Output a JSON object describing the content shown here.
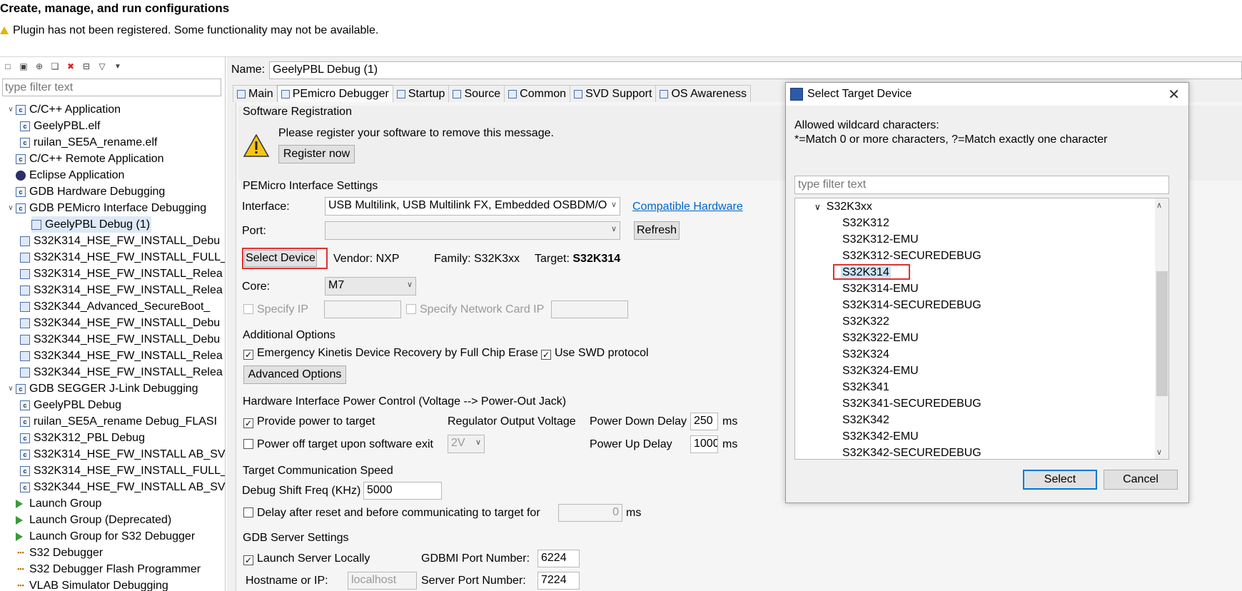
{
  "window_title": "Create, manage, and run configurations",
  "warning": "Plugin has not been registered. Some functionality may not be available.",
  "left": {
    "filter_placeholder": "type filter text",
    "items": [
      {
        "label": "C/C++ Application",
        "expanded": true
      },
      {
        "label": "GeelyPBL.elf"
      },
      {
        "label": "ruilan_SE5A_rename.elf"
      },
      {
        "label": "C/C++ Remote Application"
      },
      {
        "label": "Eclipse Application"
      },
      {
        "label": "GDB Hardware Debugging"
      },
      {
        "label": "GDB PEMicro Interface Debugging",
        "expanded": true
      },
      {
        "label": "GeelyPBL Debug (1)",
        "selected": true
      },
      {
        "label": "S32K314_HSE_FW_INSTALL_Debu"
      },
      {
        "label": "S32K314_HSE_FW_INSTALL_FULL_"
      },
      {
        "label": "S32K314_HSE_FW_INSTALL_Relea"
      },
      {
        "label": "S32K314_HSE_FW_INSTALL_Relea"
      },
      {
        "label": "S32K344_Advanced_SecureBoot_"
      },
      {
        "label": "S32K344_HSE_FW_INSTALL_Debu"
      },
      {
        "label": "S32K344_HSE_FW_INSTALL_Debu"
      },
      {
        "label": "S32K344_HSE_FW_INSTALL_Relea"
      },
      {
        "label": "S32K344_HSE_FW_INSTALL_Relea"
      },
      {
        "label": "GDB SEGGER J-Link Debugging",
        "expanded": true
      },
      {
        "label": "GeelyPBL Debug"
      },
      {
        "label": "ruilan_SE5A_rename Debug_FLASI"
      },
      {
        "label": "S32K312_PBL Debug"
      },
      {
        "label": "S32K314_HSE_FW_INSTALL AB_SV"
      },
      {
        "label": "S32K314_HSE_FW_INSTALL_FULL_"
      },
      {
        "label": "S32K344_HSE_FW_INSTALL AB_SV"
      },
      {
        "label": "Launch Group"
      },
      {
        "label": "Launch Group (Deprecated)"
      },
      {
        "label": "Launch Group for S32 Debugger"
      },
      {
        "label": "S32 Debugger"
      },
      {
        "label": "S32 Debugger Flash Programmer"
      },
      {
        "label": "VLAB Simulator Debugging"
      }
    ]
  },
  "main": {
    "name_label": "Name:",
    "name_value": "GeelyPBL Debug (1)",
    "tabs": [
      "Main",
      "PEmicro Debugger",
      "Startup",
      "Source",
      "Common",
      "SVD Support",
      "OS Awareness"
    ],
    "software_registration": {
      "header": "Software Registration",
      "message": "Please register your software to remove this message.",
      "register_button": "Register now"
    },
    "interface_settings": {
      "header": "PEMicro Interface Settings",
      "interface_label": "Interface:",
      "interface_value": "USB Multilink, USB Multilink FX, Embedded OSBDM/O",
      "compatible_link": "Compatible Hardware",
      "port_label": "Port:",
      "port_value": "",
      "refresh_button": "Refresh",
      "select_device_button": "Select Device",
      "vendor": "Vendor: NXP",
      "family": "Family: S32K3xx",
      "target_label": "Target:",
      "target_value": "S32K314",
      "core_label": "Core:",
      "core_value": "M7",
      "specify_ip": "Specify IP",
      "specify_network": "Specify Network Card IP"
    },
    "additional": {
      "header": "Additional Options",
      "emergency": "Emergency Kinetis Device Recovery by Full Chip Erase",
      "swd": "Use SWD protocol",
      "advanced_button": "Advanced Options"
    },
    "power": {
      "header": "Hardware Interface Power Control (Voltage --> Power-Out Jack)",
      "provide": "Provide power to target",
      "regulator": "Regulator Output Voltage",
      "power_down_label": "Power Down Delay",
      "power_down_value": "250",
      "ms": "ms",
      "power_off": "Power off target upon software exit",
      "voltage": "2V",
      "power_up_label": "Power Up Delay",
      "power_up_value": "1000"
    },
    "speed": {
      "header": "Target Communication Speed",
      "shift_label": "Debug Shift Freq (KHz)",
      "shift_value": "5000",
      "delay_label": "Delay after reset and before communicating to target for",
      "delay_value": "0"
    },
    "gdb": {
      "header": "GDB Server Settings",
      "launch_local": "Launch Server Locally",
      "gdbmi_label": "GDBMI Port Number:",
      "gdbmi_value": "6224",
      "hostname_label": "Hostname or IP:",
      "hostname_value": "localhost",
      "server_label": "Server Port Number:",
      "server_value": "7224"
    }
  },
  "dialog": {
    "title": "Select Target Device",
    "wildcard_line1": "Allowed wildcard characters:",
    "wildcard_line2": "*=Match 0 or more characters, ?=Match exactly one character",
    "filter_placeholder": "type filter text",
    "group": "S32K3xx",
    "devices": [
      "S32K312",
      "S32K312-EMU",
      "S32K312-SECUREDEBUG",
      "S32K314",
      "S32K314-EMU",
      "S32K314-SECUREDEBUG",
      "S32K322",
      "S32K322-EMU",
      "S32K324",
      "S32K324-EMU",
      "S32K341",
      "S32K341-SECUREDEBUG",
      "S32K342",
      "S32K342-EMU",
      "S32K342-SECUREDEBUG"
    ],
    "selected_device": "S32K314",
    "select_button": "Select",
    "cancel_button": "Cancel"
  },
  "colors": {
    "highlight_red": "#e03030",
    "link": "#0066cc",
    "selection": "#dde9f7"
  }
}
